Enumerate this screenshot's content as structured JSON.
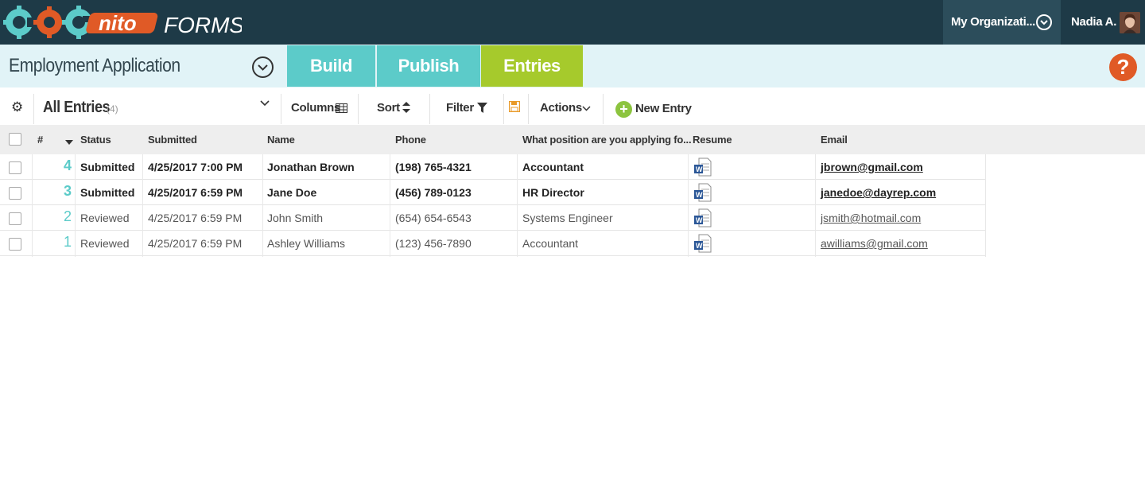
{
  "header": {
    "logo_text": "COGNITO",
    "logo_suffix": "FORMS",
    "organization": "My Organizati...",
    "user_name": "Nadia A."
  },
  "form": {
    "title": "Employment Application",
    "tabs": [
      {
        "label": "Build"
      },
      {
        "label": "Publish"
      },
      {
        "label": "Entries",
        "active": true
      }
    ],
    "help_label": "?"
  },
  "toolbar": {
    "view_name": "All Entries",
    "view_count": "(4)",
    "columns_label": "Columns",
    "sort_label": "Sort",
    "filter_label": "Filter",
    "actions_label": "Actions",
    "new_entry_label": "New Entry"
  },
  "table": {
    "headers": {
      "num": "#",
      "status": "Status",
      "submitted": "Submitted",
      "name": "Name",
      "phone": "Phone",
      "position": "What position are you applying fo...",
      "resume": "Resume",
      "email": "Email"
    },
    "rows": [
      {
        "num": "4",
        "status": "Submitted",
        "submitted": "4/25/2017 7:00 PM",
        "name": "Jonathan Brown",
        "phone": "(198) 765-4321",
        "position": "Accountant",
        "email": "jbrown@gmail.com",
        "unread": true
      },
      {
        "num": "3",
        "status": "Submitted",
        "submitted": "4/25/2017 6:59 PM",
        "name": "Jane Doe",
        "phone": "(456) 789-0123",
        "position": "HR Director",
        "email": "janedoe@dayrep.com",
        "unread": true
      },
      {
        "num": "2",
        "status": "Reviewed",
        "submitted": "4/25/2017 6:59 PM",
        "name": "John Smith",
        "phone": "(654) 654-6543",
        "position": "Systems Engineer",
        "email": "jsmith@hotmail.com",
        "unread": false
      },
      {
        "num": "1",
        "status": "Reviewed",
        "submitted": "4/25/2017 6:59 PM",
        "name": "Ashley Williams",
        "phone": "(123) 456-7890",
        "position": "Accountant",
        "email": "awilliams@gmail.com",
        "unread": false
      }
    ]
  },
  "colors": {
    "header_bg": "#1e3a47",
    "tab_teal": "#5ccbc9",
    "tab_green": "#a6ca2c",
    "help_orange": "#e05a26",
    "new_entry_green": "#8cc43f"
  }
}
